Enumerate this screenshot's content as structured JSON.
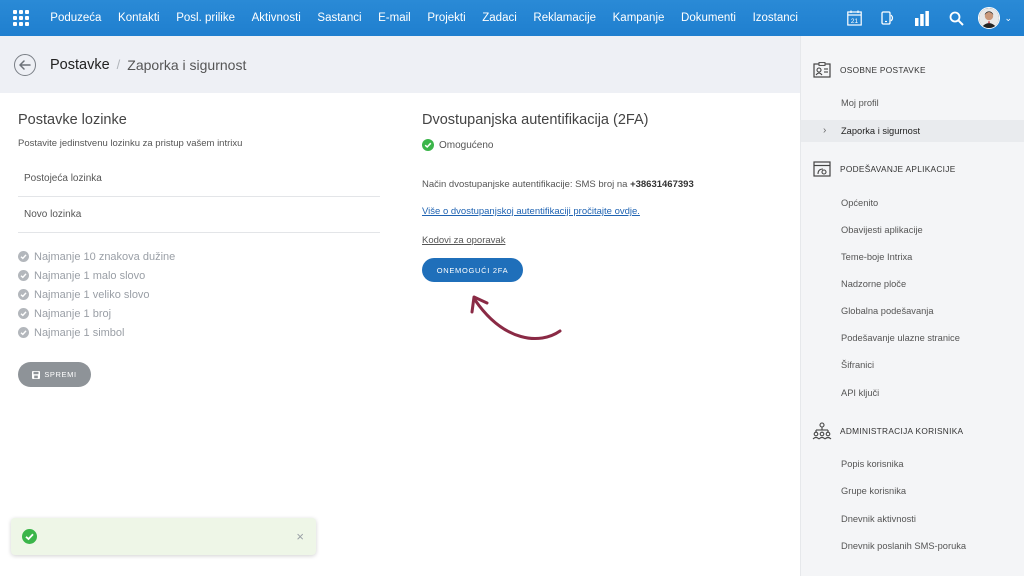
{
  "topbar": {
    "nav_items": [
      "Poduzeća",
      "Kontakti",
      "Posl. prilike",
      "Aktivnosti",
      "Sastanci",
      "E-mail",
      "Projekti",
      "Zadaci",
      "Reklamacije",
      "Kampanje",
      "Dokumenti",
      "Izostanci"
    ],
    "calendar_day": "21",
    "icons": [
      "apps-grid-icon",
      "calendar-icon",
      "phone-icon",
      "bar-chart-icon",
      "search-icon",
      "avatar",
      "chevron-down-icon"
    ]
  },
  "header": {
    "breadcrumb_main": "Postavke",
    "breadcrumb_separator": "/",
    "breadcrumb_sub": "Zaporka i sigurnost"
  },
  "password": {
    "title": "Postavke lozinke",
    "subtitle": "Postavite jedinstvenu lozinku za pristup vašem intrixu",
    "current_placeholder": "Postojeća lozinka",
    "new_placeholder": "Novo lozinka",
    "rules": [
      "Najmanje 10 znakova dužine",
      "Najmanje 1 malo slovo",
      "Najmanje 1 veliko slovo",
      "Najmanje 1 broj",
      "Najmanje 1 simbol"
    ],
    "save_label": "SPREMI"
  },
  "twofa": {
    "title": "Dvostupanjska autentifikacija (2FA)",
    "status": "Omogućeno",
    "method_prefix": "Način dvostupanjske autentifikacije: SMS broj na",
    "phone": "+38631467393",
    "more_link": "Više o dvostupanjskoj autentifikaciji pročitajte ovdje.",
    "codes_link": "Kodovi za oporavak",
    "disable_label": "ONEMOGUĆI 2FA"
  },
  "sidebar": {
    "personal_header": "OSOBNE POSTAVKE",
    "personal_items": [
      "Moj profil",
      "Zaporka i sigurnost"
    ],
    "app_header": "PODEŠAVANJE APLIKACIJE",
    "app_items": [
      "Općenito",
      "Obavijesti aplikacije",
      "Teme-boje Intrixa",
      "Nadzorne ploče",
      "Globalna podešavanja",
      "Podešavanje ulazne stranice",
      "Šifranici",
      "API ključi"
    ],
    "admin_header": "ADMINISTRACIJA KORISNIKA",
    "admin_items": [
      "Popis korisnika",
      "Grupe korisnika",
      "Dnevnik aktivnosti",
      "Dnevnik poslanih SMS-poruka"
    ]
  },
  "colors": {
    "nav_bar": "#1f7fcf",
    "success": "#3bb54a",
    "primary_button": "#1f6fba",
    "arrow": "#8a2a45"
  }
}
